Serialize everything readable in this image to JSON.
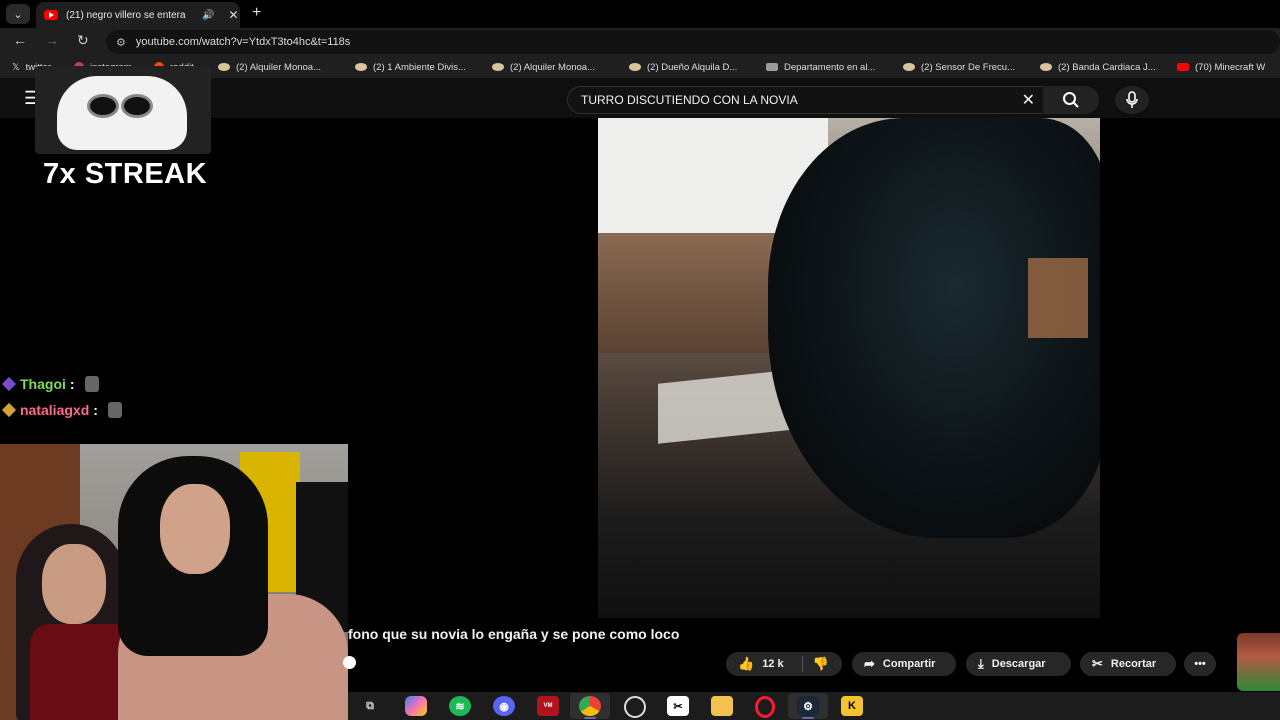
{
  "browser": {
    "tab_title": "(21) negro villero se entera",
    "url": "youtube.com/watch?v=YtdxT3to4hc&t=118s",
    "bookmarks": [
      "twitter",
      "instagram",
      "reddit",
      "(2) Alquiler Monoa...",
      "(2) 1 Ambiente Divis...",
      "(2) Alquiler Monoa...",
      "(2) Dueño Alquila D...",
      "Departamento en al...",
      "(2) Sensor De Frecu...",
      "(2) Banda Cardiaca J...",
      "(70) Minecraft W"
    ]
  },
  "youtube": {
    "search_query": "TURRO DISCUTIENDO CON LA NOVIA",
    "video_title": "fono que su novia lo engaña y se pone como loco",
    "likes": "12 k",
    "share_label": "Compartir",
    "download_label": "Descargar",
    "clip_label": "Recortar",
    "more_label": "•••"
  },
  "stream_overlay": {
    "streak_text": "7x STREAK",
    "chat": [
      {
        "user": "Thagoi",
        "sep": ":",
        "color": "#7dde5a"
      },
      {
        "user": "nataliagxd",
        "sep": ":",
        "color": "#ff6a8a"
      }
    ]
  },
  "taskbar": {
    "icons": [
      "task-view",
      "copilot",
      "spotify",
      "discord",
      "voicemeeter",
      "chrome",
      "obs",
      "capcut",
      "file-explorer",
      "opera",
      "steam",
      "kick"
    ]
  }
}
